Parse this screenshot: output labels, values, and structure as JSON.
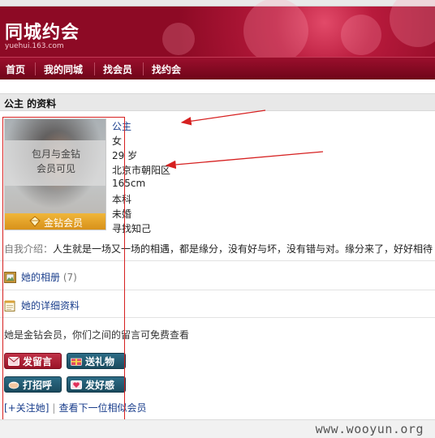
{
  "brand": {
    "logo_text": "同城约会",
    "sub": "yuehui.163.com"
  },
  "nav": {
    "items": [
      "首页",
      "我的同城",
      "找会员",
      "找约会"
    ]
  },
  "profile": {
    "heading": "公主 的资料",
    "photo": {
      "overlay_line1": "包月与金钻",
      "overlay_line2": "会员可见",
      "badge": "金钻会员"
    },
    "info": [
      "公主",
      "女",
      "29 岁",
      "北京市朝阳区",
      "165cm",
      "本科",
      "未婚",
      "寻找知己"
    ],
    "intro_label": "自我介绍：",
    "intro_text": "人生就是一场又一场的相遇，都是缘分，没有好与坏，没有错与对。缘分来了，好好相待"
  },
  "links": {
    "album": "她的相册",
    "album_count": "(7)",
    "details": "她的详细资料"
  },
  "message": "她是金钻会员，你们之间的留言可免费查看",
  "buttons": {
    "leave_message": "发留言",
    "send_gift": "送礼物",
    "greet": "打招呼",
    "like": "发好感"
  },
  "actions": {
    "follow": "[+关注她]",
    "next": "查看下一位相似会员"
  },
  "watermark": "www.wooyun.org",
  "colors": {
    "accent": "#9b0f2d",
    "link": "#1a3e8c",
    "annotation": "#d62020",
    "gold": "#e5a22a"
  }
}
